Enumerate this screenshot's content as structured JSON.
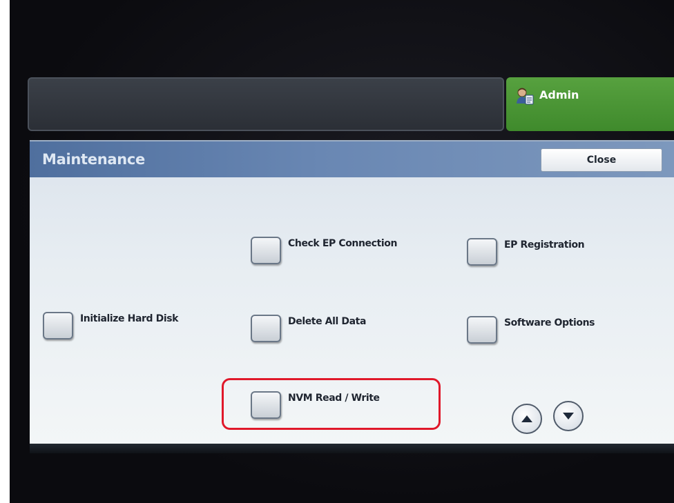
{
  "header": {
    "user_label": "Admin",
    "user_icon": "admin-user-icon"
  },
  "dialog": {
    "title": "Maintenance",
    "close_label": "Close"
  },
  "options": {
    "check_ep_connection": "Check EP Connection",
    "ep_registration": "EP Registration",
    "initialize_hard_disk": "Initialize Hard Disk",
    "delete_all_data": "Delete All Data",
    "software_options": "Software Options",
    "nvm_read_write": "NVM Read / Write"
  },
  "scroll": {
    "up_icon": "arrow-up-icon",
    "down_icon": "arrow-down-icon"
  },
  "colors": {
    "header_blue": "#5b7aa8",
    "admin_green": "#4c9a38",
    "highlight_red": "#e0182a"
  }
}
